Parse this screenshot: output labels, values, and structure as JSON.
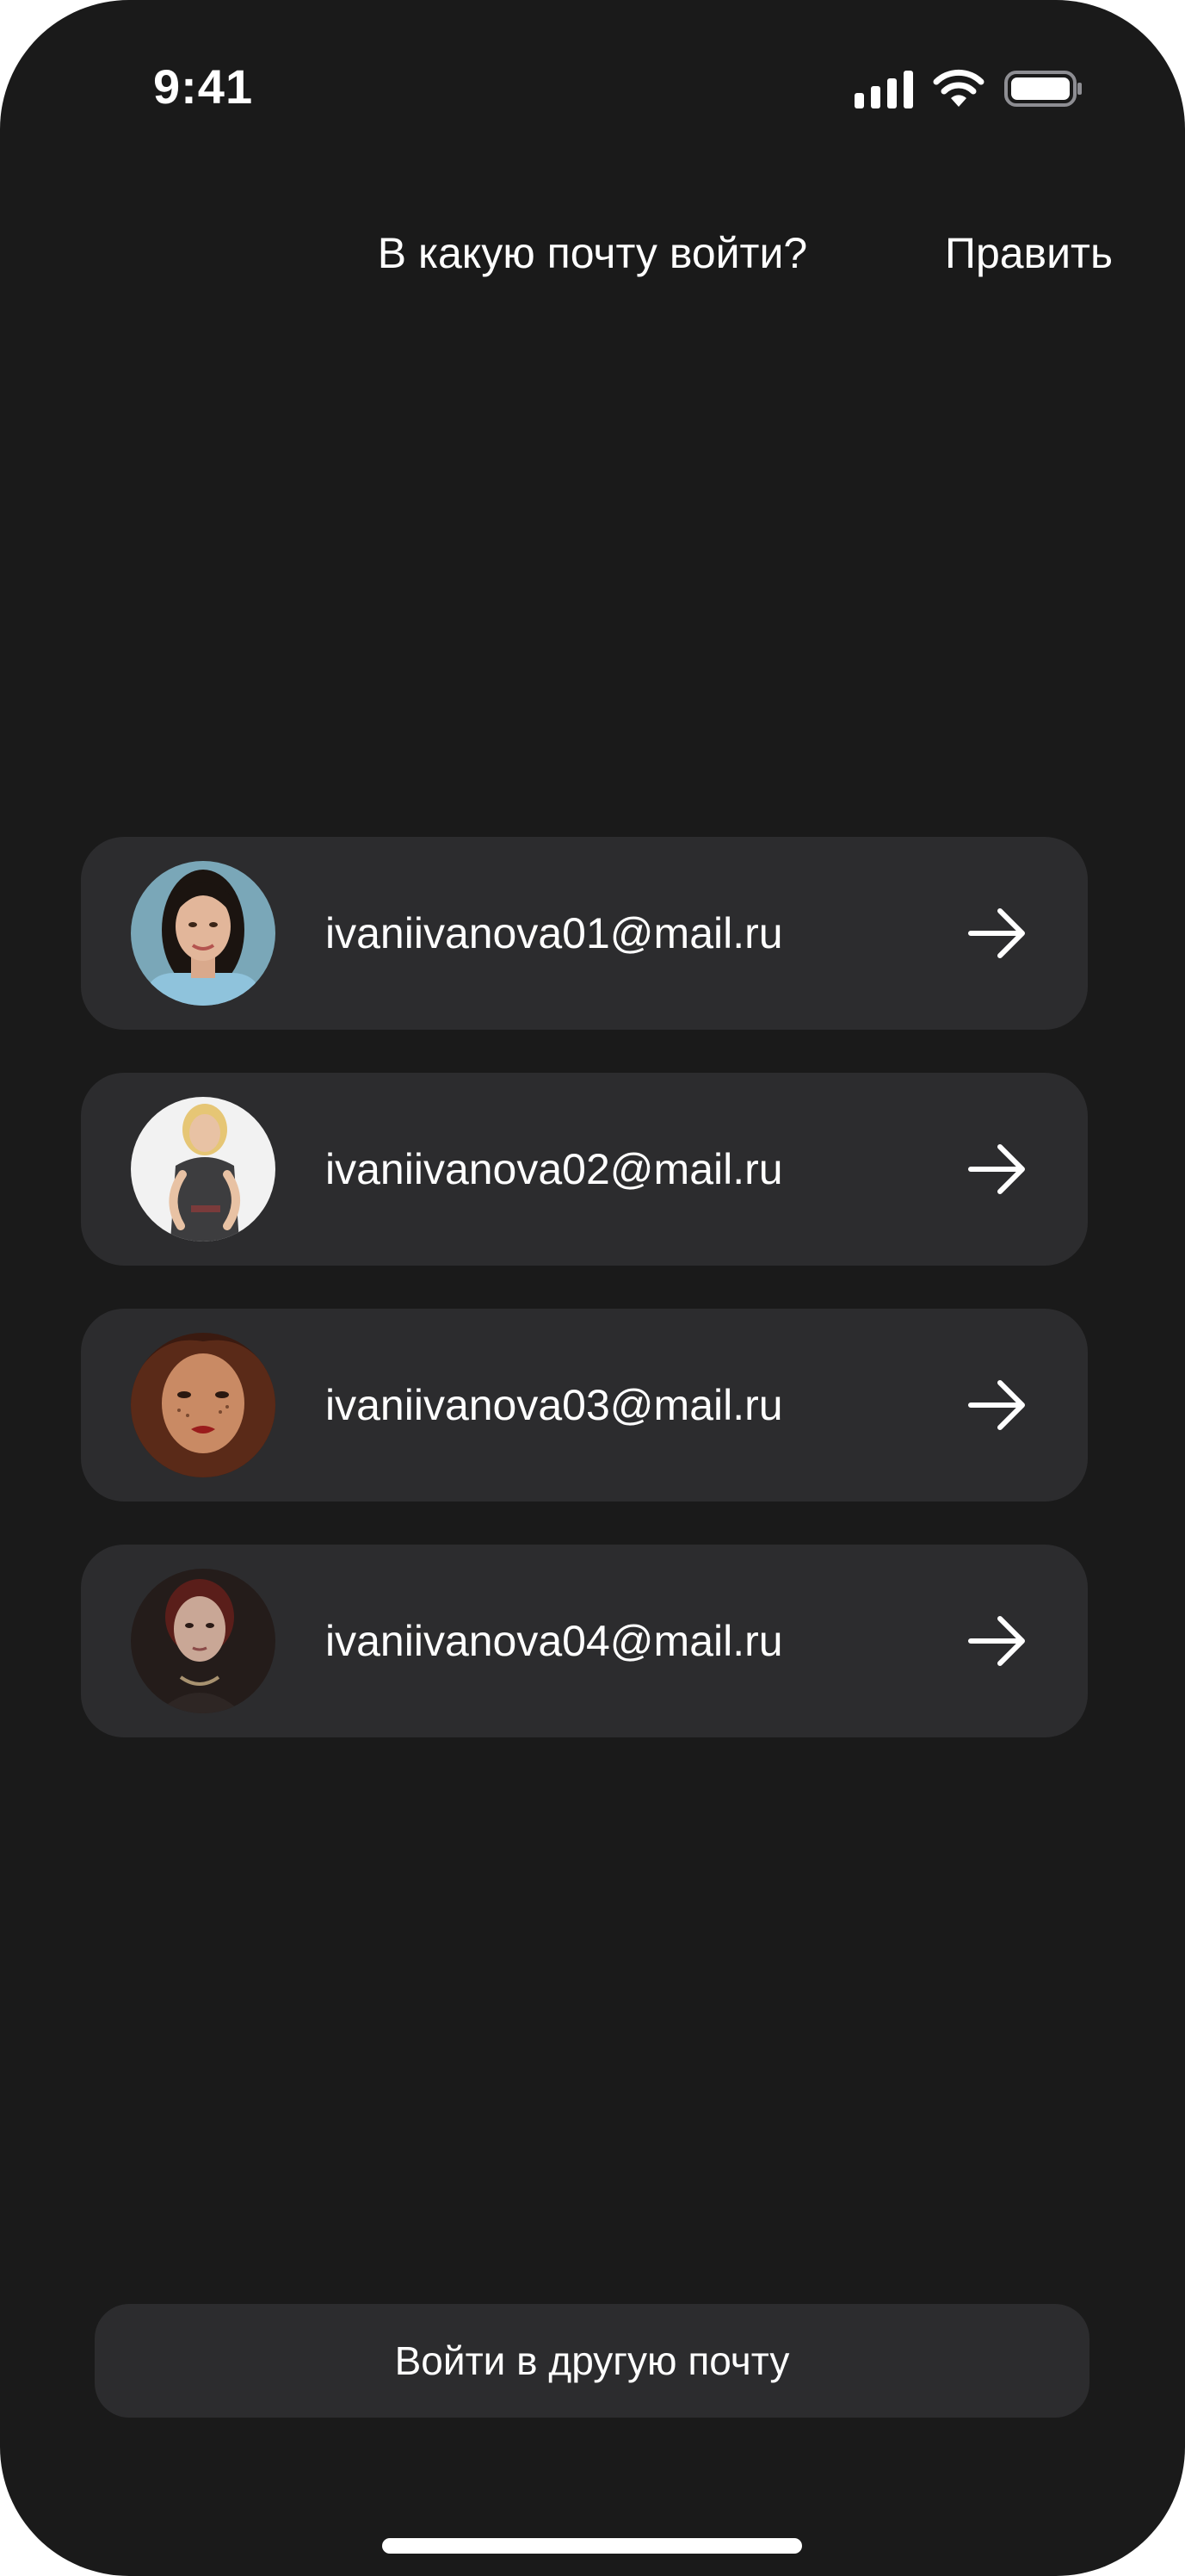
{
  "status_bar": {
    "time": "9:41",
    "icons": [
      "cellular-signal-icon",
      "wifi-icon",
      "battery-icon"
    ]
  },
  "header": {
    "title": "В какую почту войти?",
    "edit_label": "Править"
  },
  "accounts": [
    {
      "email": "ivaniivanova01@mail.ru",
      "avatar": "avatar-photo-1"
    },
    {
      "email": "ivaniivanova02@mail.ru",
      "avatar": "avatar-photo-2"
    },
    {
      "email": "ivaniivanova03@mail.ru",
      "avatar": "avatar-photo-3"
    },
    {
      "email": "ivaniivanova04@mail.ru",
      "avatar": "avatar-photo-4"
    }
  ],
  "footer": {
    "other_mail_label": "Войти в другую почту"
  },
  "colors": {
    "background": "#1a1a1a",
    "card": "#2c2c2e",
    "text": "#ffffff"
  }
}
